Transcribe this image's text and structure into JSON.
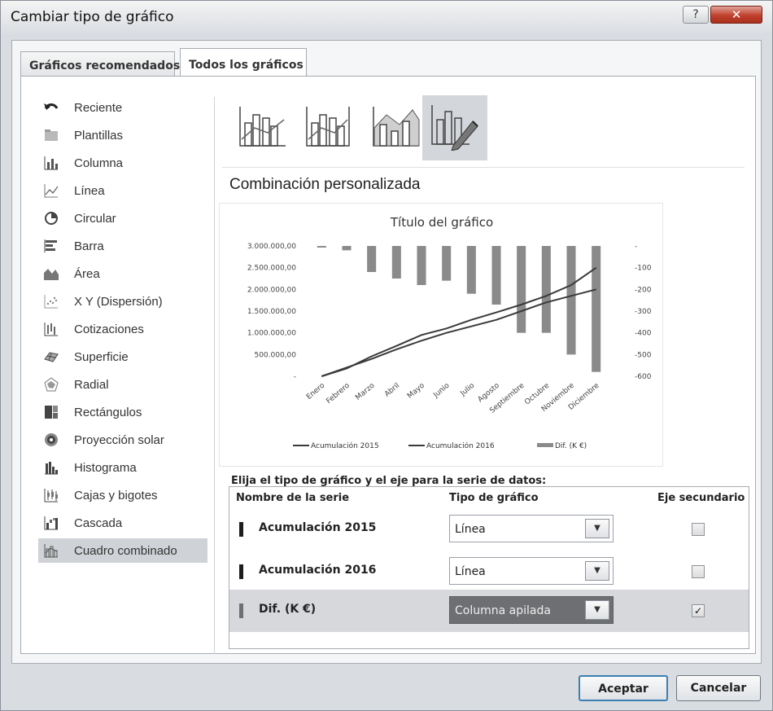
{
  "window": {
    "title": "Cambiar tipo de gráfico"
  },
  "tabs": [
    {
      "label": "Gráficos recomendados",
      "active": false
    },
    {
      "label": "Todos los gráficos",
      "active": true
    }
  ],
  "sidebar": {
    "items": [
      {
        "label": "Reciente",
        "icon": "undo-icon"
      },
      {
        "label": "Plantillas",
        "icon": "folder-icon"
      },
      {
        "label": "Columna",
        "icon": "column-chart-icon"
      },
      {
        "label": "Línea",
        "icon": "line-chart-icon"
      },
      {
        "label": "Circular",
        "icon": "pie-chart-icon"
      },
      {
        "label": "Barra",
        "icon": "bar-chart-icon"
      },
      {
        "label": "Área",
        "icon": "area-chart-icon"
      },
      {
        "label": "X Y (Dispersión)",
        "icon": "scatter-chart-icon"
      },
      {
        "label": "Cotizaciones",
        "icon": "stock-chart-icon"
      },
      {
        "label": "Superficie",
        "icon": "surface-chart-icon"
      },
      {
        "label": "Radial",
        "icon": "radar-chart-icon"
      },
      {
        "label": "Rectángulos",
        "icon": "treemap-chart-icon"
      },
      {
        "label": "Proyección solar",
        "icon": "sunburst-chart-icon"
      },
      {
        "label": "Histograma",
        "icon": "histogram-chart-icon"
      },
      {
        "label": "Cajas y bigotes",
        "icon": "box-whisker-chart-icon"
      },
      {
        "label": "Cascada",
        "icon": "waterfall-chart-icon"
      },
      {
        "label": "Cuadro combinado",
        "icon": "combo-chart-icon",
        "selected": true
      }
    ]
  },
  "combo_types": [
    {
      "icon": "combo-clustered-column-line-icon"
    },
    {
      "icon": "combo-column-line-secondary-icon"
    },
    {
      "icon": "combo-stacked-area-column-icon"
    },
    {
      "icon": "combo-custom-icon",
      "selected": true
    }
  ],
  "section_title": "Combinación personalizada",
  "chart_data": {
    "type": "combo",
    "title": "Título del gráfico",
    "categories": [
      "Enero",
      "Febrero",
      "Marzo",
      "Abril",
      "Mayo",
      "Junio",
      "Julio",
      "Agosto",
      "Septiembre",
      "Octubre",
      "Noviembre",
      "Diciembre"
    ],
    "y_left": {
      "ticks": [
        "3.000.000,00",
        "2.500.000,00",
        "2.000.000,00",
        "1.500.000,00",
        "1.000.000,00",
        "500.000,00",
        "-"
      ],
      "range": [
        0,
        3000000
      ]
    },
    "y_right": {
      "ticks": [
        "-",
        "-100",
        "-200",
        "-300",
        "-400",
        "-500",
        "-600"
      ],
      "range": [
        -600,
        0
      ]
    },
    "series": [
      {
        "name": "Acumulación 2015",
        "type": "line",
        "axis": "primary",
        "color": "#3a3a3a",
        "values": [
          0,
          200000,
          400000,
          620000,
          820000,
          1000000,
          1150000,
          1300000,
          1500000,
          1700000,
          1850000,
          2000000
        ]
      },
      {
        "name": "Acumulación 2016",
        "type": "line",
        "axis": "primary",
        "color": "#3a3a3a",
        "values": [
          0,
          180000,
          460000,
          700000,
          950000,
          1100000,
          1300000,
          1470000,
          1650000,
          1850000,
          2100000,
          2500000
        ]
      },
      {
        "name": "Dif. (K €)",
        "type": "stacked_column",
        "axis": "secondary",
        "color": "#8a8a8a",
        "values": [
          -5,
          -20,
          -120,
          -150,
          -180,
          -160,
          -220,
          -270,
          -400,
          -400,
          -500,
          -580
        ]
      }
    ],
    "legend_position": "bottom"
  },
  "series_table": {
    "label": "Elija el tipo de gráfico y el eje para la serie de datos:",
    "headers": {
      "name": "Nombre de la serie",
      "type": "Tipo de gráfico",
      "secondary": "Eje secundario"
    },
    "rows": [
      {
        "name": "Acumulación 2015",
        "type": "Línea",
        "secondary": false
      },
      {
        "name": "Acumulación 2016",
        "type": "Línea",
        "secondary": false
      },
      {
        "name": "Dif. (K €)",
        "type": "Columna apilada",
        "secondary": true
      }
    ]
  },
  "buttons": {
    "ok": "Aceptar",
    "cancel": "Cancelar"
  },
  "help_label": "?",
  "close_label": "✕"
}
